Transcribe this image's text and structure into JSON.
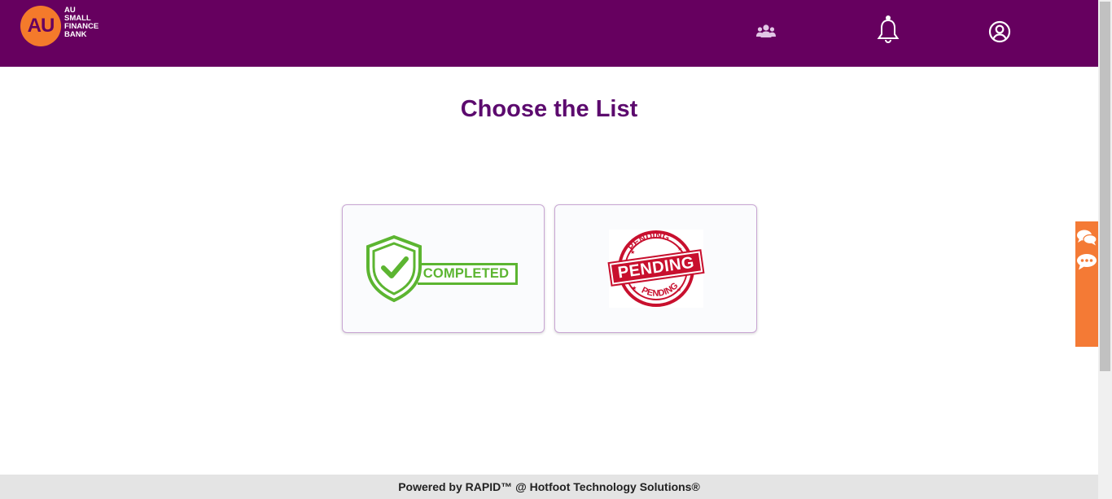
{
  "header": {
    "logo_mark": "AU",
    "logo_lines": [
      "AU",
      "SMALL",
      "FINANCE",
      "BANK"
    ],
    "icons": [
      "users-icon",
      "bell-icon",
      "user-account-icon"
    ]
  },
  "main": {
    "title": "Choose the List",
    "cards": [
      {
        "name": "completed",
        "label": "COMPLETED",
        "icon": "shield-check-icon"
      },
      {
        "name": "pending",
        "label": "PENDING",
        "stamp_top": "PENDING",
        "stamp_bottom": "PENDING"
      }
    ]
  },
  "side_panel": {
    "icons": [
      "chat-bubbles-icon",
      "chat-dots-icon"
    ]
  },
  "footer": {
    "text": "Powered by RAPID™ @ Hotfoot Technology Solutions®"
  },
  "colors": {
    "header_bg": "#66005f",
    "logo_orange": "#f47a2b",
    "title_purple": "#5c0a6e",
    "completed_green": "#5cb531",
    "pending_red": "#c8102e",
    "side_panel_orange": "#f47a35"
  }
}
